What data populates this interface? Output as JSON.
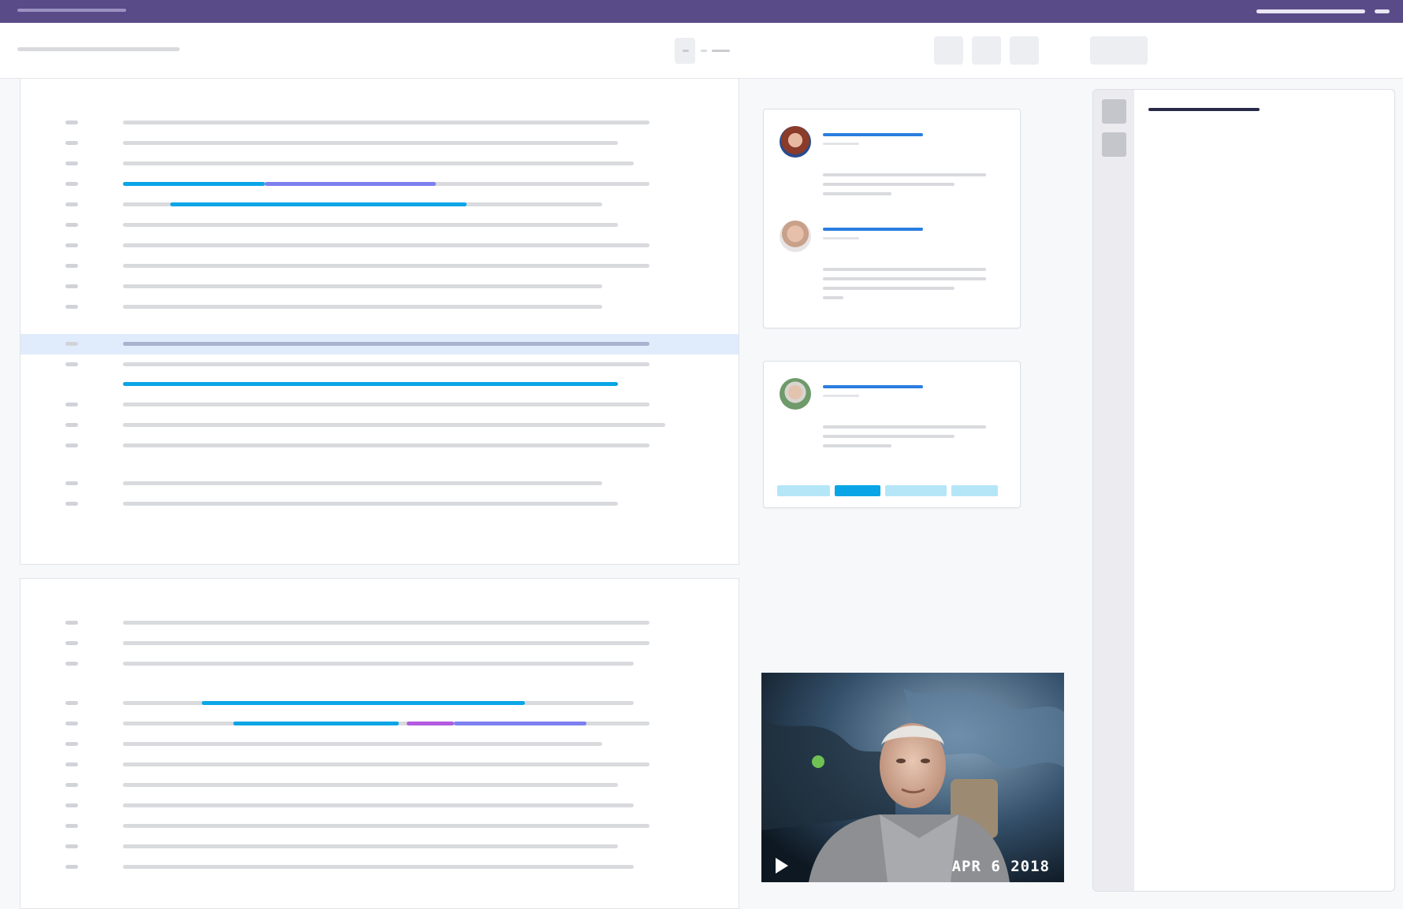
{
  "colors": {
    "topbar": "#594b88",
    "accent_blue": "#0aa5e6",
    "link_blue": "#2a7ee0",
    "accent_violet": "#7d7ff0",
    "accent_magenta": "#b25be0",
    "selected_row": "#e0ecfb",
    "placeholder_gray": "#d1d3d9"
  },
  "icons": [
    "play-icon",
    "avatar-woman",
    "avatar-bald-man",
    "avatar-older-man"
  ],
  "video": {
    "date_label": "APR 6 2018"
  }
}
